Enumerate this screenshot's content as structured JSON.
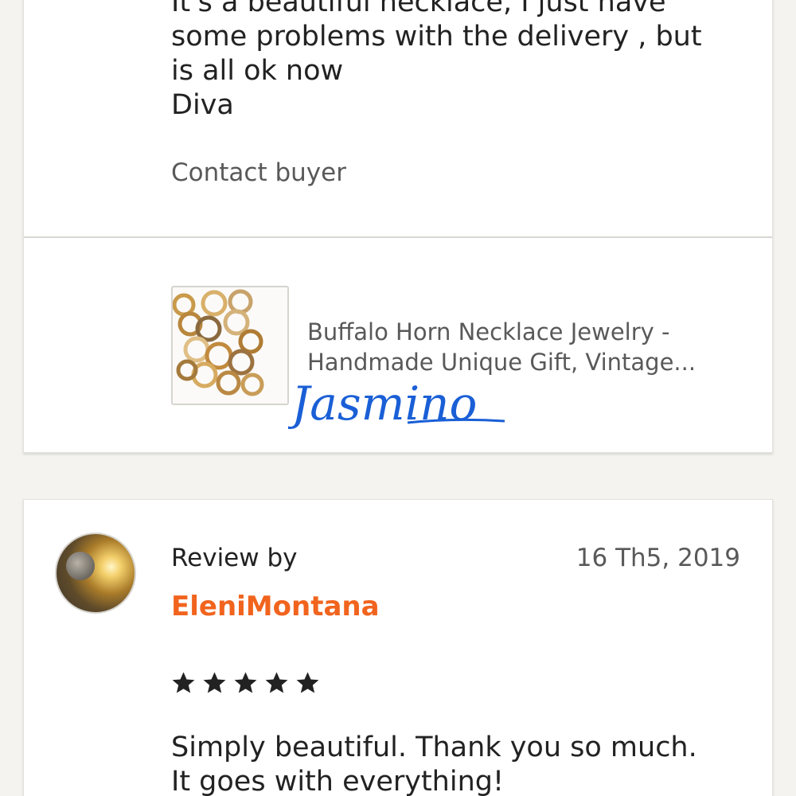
{
  "review_1": {
    "text_lines": [
      "It's a beautiful necklace, I just have",
      "some problems with the delivery , but",
      "is all ok now",
      "Diva"
    ],
    "contact_label": "Contact buyer",
    "product": {
      "thumbnail_icon": "necklace-image",
      "title_lines": [
        "Buffalo Horn Necklace Jewelry -",
        "Handmade Unique Gift, Vintage..."
      ]
    },
    "watermark": "Jasmino"
  },
  "review_2": {
    "avatar_icon": "user-avatar",
    "review_by_label": "Review by",
    "reviewer_name": "EleniMontana",
    "date": "16 Th5, 2019",
    "rating": 5,
    "rating_max": 5,
    "text_lines": [
      "Simply beautiful. Thank you so much.",
      "It goes with everything!"
    ]
  },
  "colors": {
    "background": "#f4f3ef",
    "card": "#ffffff",
    "text": "#222222",
    "muted_text": "#595959",
    "reviewer_name": "#f1641e",
    "watermark": "#1a5fd6",
    "star": "#222222"
  }
}
